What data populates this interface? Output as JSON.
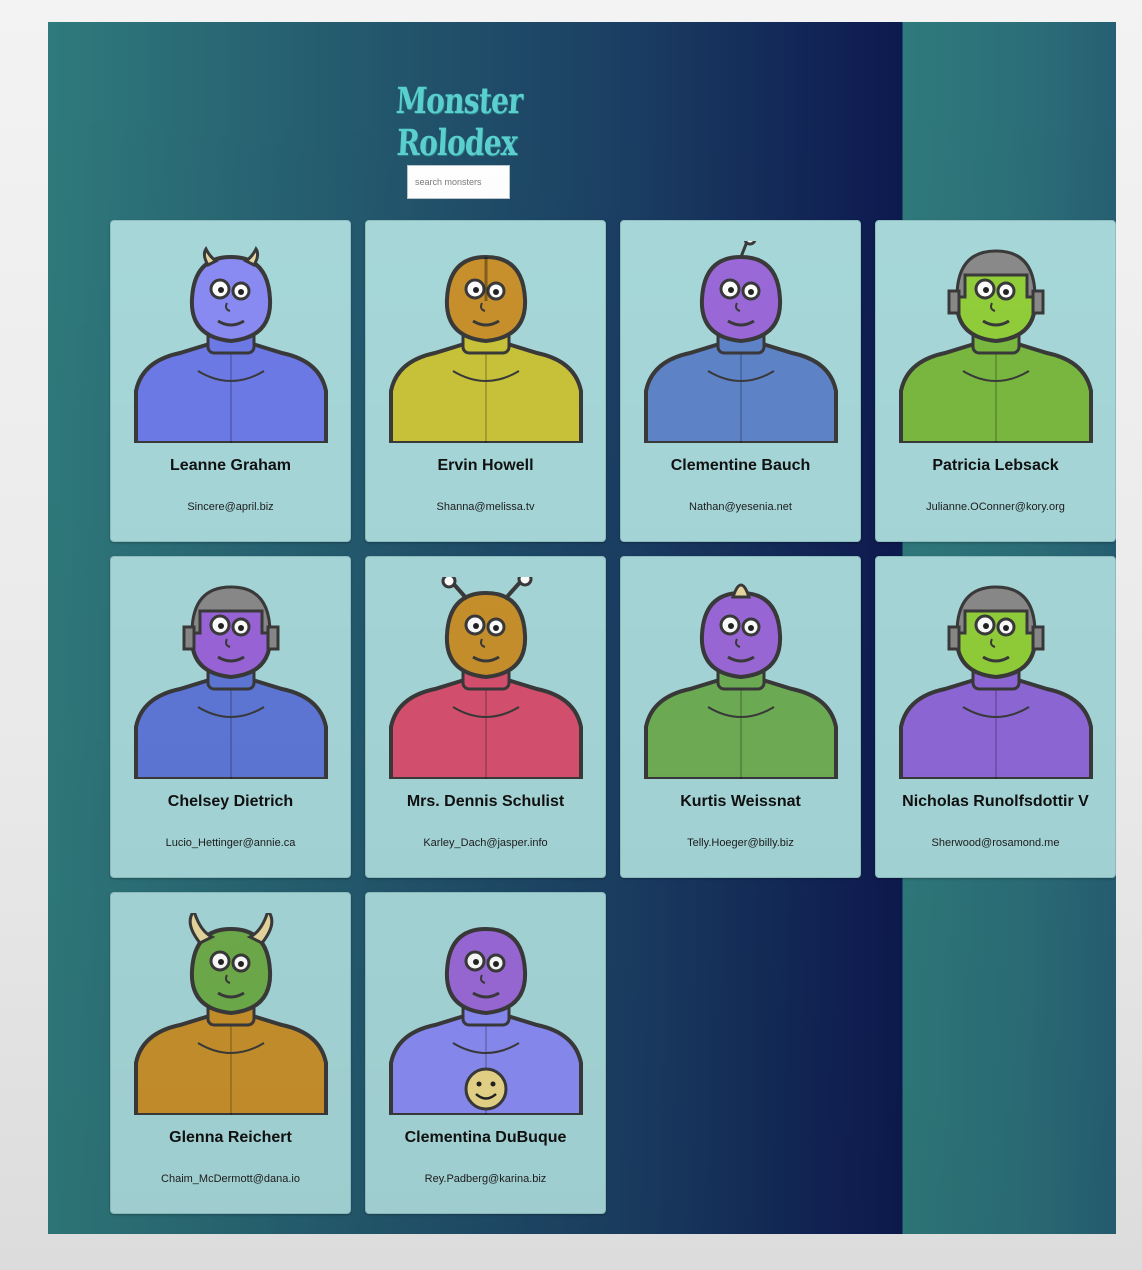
{
  "app": {
    "title": "Monster Rolodex",
    "search": {
      "placeholder": "search monsters",
      "value": ""
    }
  },
  "monsters": [
    {
      "name": "Leanne Graham",
      "email": "Sincere@april.biz",
      "head_color": "#8a8cf5",
      "body_color": "#6d7be8",
      "accessory": "small-horns"
    },
    {
      "name": "Ervin Howell",
      "email": "Shanna@melissa.tv",
      "head_color": "#c9912c",
      "body_color": "#c9c43a",
      "accessory": "helmet-ridge"
    },
    {
      "name": "Clementine Bauch",
      "email": "Nathan@yesenia.net",
      "head_color": "#9b69d9",
      "body_color": "#5f84c9",
      "accessory": "antenna"
    },
    {
      "name": "Patricia Lebsack",
      "email": "Julianne.OConner@kory.org",
      "head_color": "#92cf3a",
      "body_color": "#7ab941",
      "accessory": "robot-helmet"
    },
    {
      "name": "Chelsey Dietrich",
      "email": "Lucio_Hettinger@annie.ca",
      "head_color": "#9b65d9",
      "body_color": "#5f78d8",
      "accessory": "robot-helmet"
    },
    {
      "name": "Mrs. Dennis Schulist",
      "email": "Karley_Dach@jasper.info",
      "head_color": "#c9912c",
      "body_color": "#d85070",
      "accessory": "antennae"
    },
    {
      "name": "Kurtis Weissnat",
      "email": "Telly.Hoeger@billy.biz",
      "head_color": "#9b69d9",
      "body_color": "#6fae55",
      "accessory": "horn"
    },
    {
      "name": "Nicholas Runolfsdottir V",
      "email": "Sherwood@rosamond.me",
      "head_color": "#92cf3a",
      "body_color": "#8f68d8",
      "accessory": "robot-helmet"
    },
    {
      "name": "Glenna Reichert",
      "email": "Chaim_McDermott@dana.io",
      "head_color": "#6fae4b",
      "body_color": "#c9912c",
      "accessory": "big-horns"
    },
    {
      "name": "Clementina DuBuque",
      "email": "Rey.Padberg@karina.biz",
      "head_color": "#9b69d9",
      "body_color": "#8a8cf5",
      "accessory": "smiley-shirt"
    }
  ]
}
